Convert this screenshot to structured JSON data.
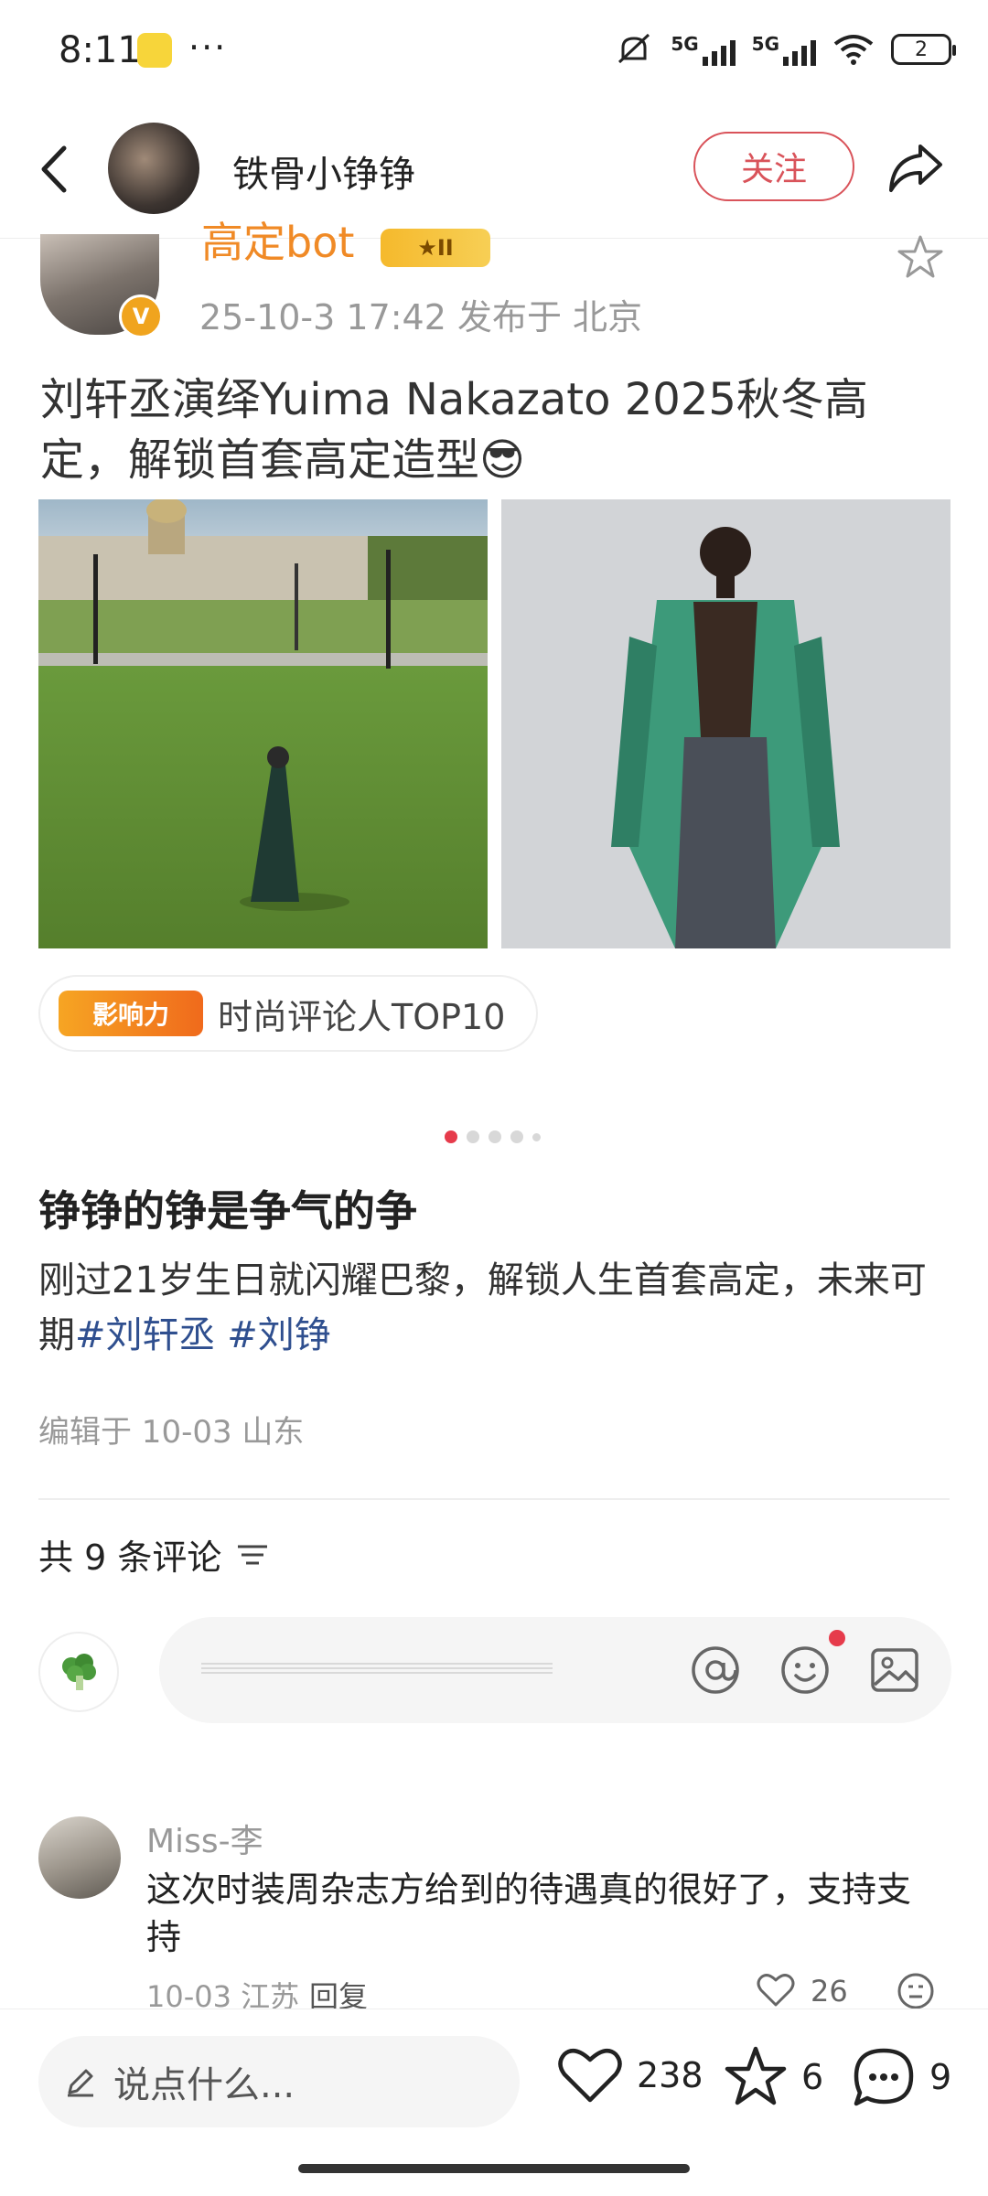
{
  "status_bar": {
    "time": "8:11",
    "dots": "···",
    "network1": "5G",
    "network2": "5G",
    "battery": "2"
  },
  "header": {
    "author_name": "铁骨小铮铮",
    "follow_label": "关注"
  },
  "quoted_post": {
    "author": "高定bot",
    "level": "II",
    "meta": "25-10-3 17:42   发布于 北京",
    "text": "刘轩丞演绎Yuima Nakazato 2025秋冬高定，解锁首套高定造型😎",
    "influence_badge": "影响力",
    "influence_text": "时尚评论人TOP10"
  },
  "post": {
    "title": "铮铮的铮是争气的争",
    "body_text": "刚过21岁生日就闪耀巴黎，解锁人生首套高定，未来可期",
    "hashtag1": "#刘轩丞",
    "hashtag2": " #刘铮",
    "edit_info": "编辑于 10-03 山东"
  },
  "comments": {
    "count_label": "共 9 条评论",
    "items": [
      {
        "name": "Miss-李",
        "text": "这次时装周杂志方给到的待遇真的很好了，支持支持",
        "meta": "10-03 江苏",
        "reply": "回复",
        "likes": "26"
      }
    ]
  },
  "bottom_bar": {
    "placeholder": "说点什么...",
    "likes": "238",
    "favorites": "6",
    "comments": "9"
  },
  "colors": {
    "accent_red": "#e63b4b",
    "follow_red": "#d9535a",
    "orange": "#f08a26",
    "hashtag_blue": "#2f4f8f"
  }
}
